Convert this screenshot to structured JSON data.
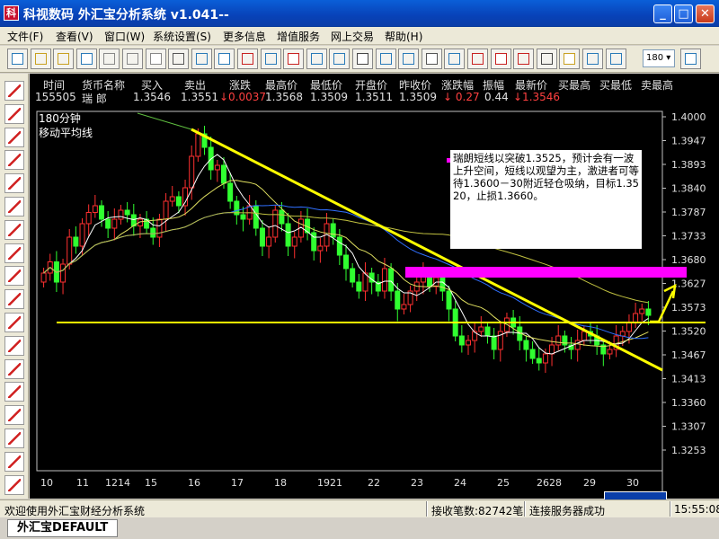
{
  "window": {
    "title": "科视数码  外汇宝分析系统  v1.041--",
    "icon_label": "科",
    "minimize": "_",
    "maximize": "□",
    "close": "✕"
  },
  "menu": [
    "文件(F)",
    "查看(V)",
    "窗口(W)",
    "系统设置(S)",
    "更多信息",
    "增值服务",
    "网上交易",
    "帮助(H)"
  ],
  "toolbar": {
    "zoom_value": "180",
    "icons": [
      "new-icon",
      "open-icon",
      "folder-icon",
      "save-icon",
      "cut-icon",
      "copy-icon",
      "paste-icon",
      "print-icon",
      "grid-icon",
      "list-icon",
      "bar-chart-icon",
      "line-chart-icon",
      "chart-icon",
      "trend-icon",
      "indicator-icon",
      "book-icon",
      "crossline-icon",
      "table-icon",
      "clock-icon",
      "stats-icon",
      "news-icon",
      "alert-icon",
      "draw-icon",
      "calc-icon",
      "hand-icon",
      "zoom-in-icon",
      "zoom-out-icon",
      "calendar-icon"
    ]
  },
  "left_tools": [
    "trend-line-icon",
    "fan-line-icon",
    "tik-icon",
    "parallel-icon",
    "arrow-line-icon",
    "ray-icon",
    "segment-icon",
    "fibonacci-icon",
    "box-icon",
    "delete-icon",
    "eraser-icon",
    "channel-icon",
    "cycle-icon",
    "tangent-icon",
    "circle-add-icon",
    "circle-remove-icon",
    "measure-icon",
    "wave-icon"
  ],
  "quote": {
    "headers": [
      "时间",
      "货币名称",
      "买入",
      "卖出",
      "涨跌",
      "最高价",
      "最低价",
      "开盘价",
      "昨收价",
      "涨跌幅",
      "振幅",
      "最新价",
      "买最高",
      "买最低",
      "卖最高"
    ],
    "values": {
      "time": "155505",
      "name": "瑞      郎",
      "bid": "1.3546",
      "ask": "1.3551",
      "change": "↓0.0037",
      "high": "1.3568",
      "low": "1.3509",
      "open": "1.3511",
      "prev_close": "1.3509",
      "change_pct": "↓  0.27",
      "amplitude": "0.44",
      "latest": "↓1.3546"
    }
  },
  "chart_data": {
    "type": "candlestick",
    "period_label": "180分钟",
    "indicator_label": "移动平均线",
    "y_axis": {
      "ticks": [
        "1.4000",
        "1.3947",
        "1.3893",
        "1.3840",
        "1.3787",
        "1.3733",
        "1.3680",
        "1.3627",
        "1.3573",
        "1.3520",
        "1.3467",
        "1.3413",
        "1.3360",
        "1.3307",
        "1.3253"
      ],
      "range": [
        1.32,
        1.4
      ]
    },
    "x_axis": {
      "ticks": [
        "10",
        "11",
        "1214",
        "15",
        "16",
        "17",
        "18",
        "1921",
        "22",
        "23",
        "24",
        "25",
        "2628",
        "29",
        "30"
      ]
    },
    "annotation": "瑞朗短线以突破1.3525，预计会有一波上升空间，短线以观望为主，激进者可等待1.3600－30附近轻仓吸纳，目标1.3520，止损1.3660。",
    "close_series": [
      1.364,
      1.3665,
      1.362,
      1.366,
      1.372,
      1.37,
      1.375,
      1.3775,
      1.379,
      1.376,
      1.374,
      1.376,
      1.378,
      1.377,
      1.3745,
      1.376,
      1.374,
      1.372,
      1.376,
      1.38,
      1.381,
      1.379,
      1.383,
      1.39,
      1.395,
      1.392,
      1.387,
      1.388,
      1.384,
      1.38,
      1.377,
      1.376,
      1.379,
      1.374,
      1.37,
      1.372,
      1.378,
      1.375,
      1.37,
      1.372,
      1.376,
      1.373,
      1.369,
      1.37,
      1.375,
      1.372,
      1.368,
      1.365,
      1.362,
      1.36,
      1.364,
      1.362,
      1.36,
      1.365,
      1.36,
      1.356,
      1.357,
      1.36,
      1.362,
      1.364,
      1.361,
      1.363,
      1.36,
      1.356,
      1.35,
      1.348,
      1.349,
      1.351,
      1.352,
      1.35,
      1.347,
      1.351,
      1.354,
      1.352,
      1.349,
      1.347,
      1.345,
      1.344,
      1.346,
      1.348,
      1.35,
      1.348,
      1.347,
      1.349,
      1.351,
      1.35,
      1.348,
      1.346,
      1.347,
      1.35,
      1.351,
      1.353,
      1.355,
      1.356,
      1.3546
    ],
    "lines": [
      {
        "kind": "trendline",
        "color": "#ffff00",
        "from": [
          "16",
          1.396
        ],
        "to": [
          "30",
          1.344
        ]
      },
      {
        "kind": "horizontal",
        "color": "#ffff00",
        "price": 1.353
      },
      {
        "kind": "zone",
        "color": "#ff00ff",
        "price": 1.364
      }
    ]
  },
  "status": {
    "welcome": "欢迎使用外汇宝财经分析系统",
    "count": "接收笔数:82742笔",
    "server": "连接服务器成功",
    "time": "15:55:08"
  },
  "tab": "外汇宝DEFAULT"
}
